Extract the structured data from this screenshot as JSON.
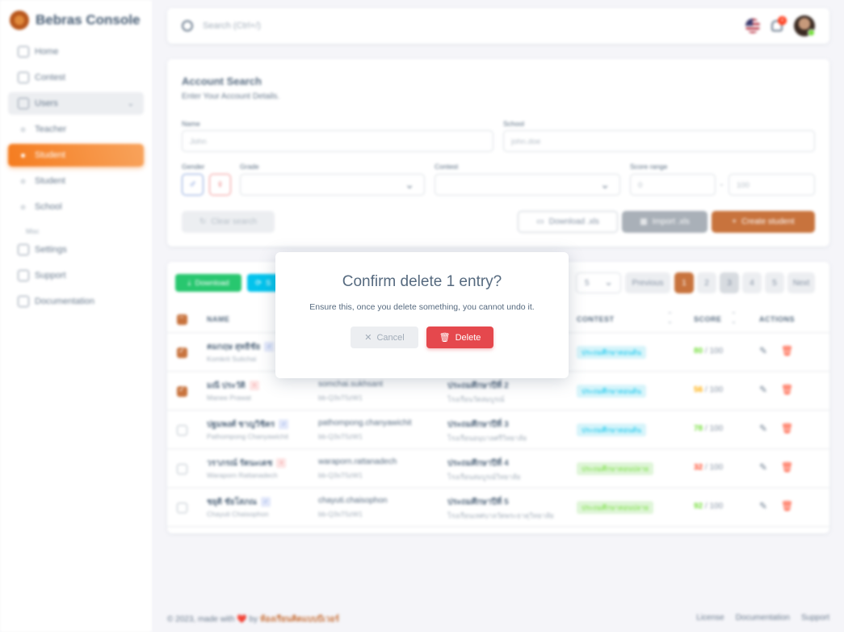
{
  "app": {
    "name": "Bebras Console"
  },
  "sidebar": {
    "items": [
      {
        "label": "Home"
      },
      {
        "label": "Contest"
      },
      {
        "label": "Users"
      }
    ],
    "users_sub": [
      {
        "label": "Teacher"
      },
      {
        "label": "Student"
      },
      {
        "label": "Student"
      },
      {
        "label": "School"
      }
    ],
    "misc_header": "Misc",
    "misc_items": [
      {
        "label": "Settings"
      },
      {
        "label": "Support"
      },
      {
        "label": "Documentation"
      }
    ]
  },
  "navbar": {
    "search_placeholder": "Search (Ctrl+/)",
    "notifications_count": "4"
  },
  "account_search": {
    "title": "Account Search",
    "subtitle": "Enter Your Account Details.",
    "name_label": "Name",
    "name_placeholder": "John",
    "school_label": "School",
    "school_placeholder": "john.doe",
    "gender_label": "Gender",
    "grade_label": "Grade",
    "contest_label": "Contest",
    "score_range_label": "Score range",
    "score_min_placeholder": "0",
    "score_dash": "-",
    "score_max_placeholder": "100",
    "clear_label": "Clear search",
    "download_label": "Download .xls",
    "import_label": "Import .xls",
    "create_label": "Create student"
  },
  "table": {
    "download_label": "Download",
    "partial_button_label": "S",
    "page_size": "5",
    "pagination": {
      "previous": "Previous",
      "pages": [
        "1",
        "2",
        "3",
        "4",
        "5"
      ],
      "next": "Next",
      "current": "1"
    },
    "headers": {
      "name": "NAME",
      "contest": "CONTEST",
      "score": "SCORE",
      "actions": "ACTIONS"
    },
    "rows": [
      {
        "name": "คมกฤษ สุทธิชัย",
        "name_en": "Komkrit Sutichai",
        "gender": "male",
        "username": "",
        "password": "",
        "level": "",
        "school": "",
        "contest": "ประถมศึกษาตอนต้น",
        "contest_type": "c1",
        "score": "80",
        "max": "/ 100",
        "score_color": "#71dd37",
        "checked": true
      },
      {
        "name": "มณี ประวัติ",
        "name_en": "Manee Prawat",
        "gender": "female",
        "username": "somchai.sukhsant",
        "password": "bb-Q3sT5zW1",
        "level": "ประถมศึกษาปีที่ 2",
        "school": "โรงเรียนวัดสมบูรณ์",
        "contest": "ประถมศึกษาตอนต้น",
        "contest_type": "c1",
        "score": "56",
        "max": "/ 100",
        "score_color": "#ffab00",
        "checked": true
      },
      {
        "name": "ปฐมพงศ์ ชาญวิชิตร",
        "name_en": "Pathompong Chanyawichit",
        "gender": "male",
        "username": "pathompong.chanyawichit",
        "password": "bb-Q3sT5zW1",
        "level": "ประถมศึกษาปีที่ 3",
        "school": "โรงเรียนอนุบาลศรีวิทยาลัย",
        "contest": "ประถมศึกษาตอนต้น",
        "contest_type": "c1",
        "score": "78",
        "max": "/ 100",
        "score_color": "#71dd37",
        "checked": false
      },
      {
        "name": "วราภรณ์ รัตนะเดช",
        "name_en": "Waraporn Rattanadech",
        "gender": "female",
        "username": "waraporn.rattanadech",
        "password": "bb-Q3sT5zW1",
        "level": "ประถมศึกษาปีที่ 4",
        "school": "โรงเรียนสมบูรณ์วิทยาลัย",
        "contest": "ประถมศึกษาตอนปลาย",
        "contest_type": "c2",
        "score": "32",
        "max": "/ 100",
        "score_color": "#ff3e1d",
        "checked": false
      },
      {
        "name": "ชยุติ ชัยโสภณ",
        "name_en": "Chayuti Chaisophon",
        "gender": "male",
        "username": "chayuti.chaisophon",
        "password": "bb-Q3sT5zW1",
        "level": "ประถมศึกษาปีที่ 5",
        "school": "โรงเรียนเทศบาลวัดพระธาตุวิทยาลัย",
        "contest": "ประถมศึกษาตอนปลาย",
        "contest_type": "c2",
        "score": "92",
        "max": "/ 100",
        "score_color": "#71dd37",
        "checked": false
      }
    ]
  },
  "footer": {
    "copyright": "© 2023, made with ❤️ by",
    "brand": "ห้องเรียนคิดแบบบีเวอร์",
    "links": [
      "License",
      "Documentation",
      "Support"
    ]
  },
  "modal": {
    "title": "Confirm delete 1 entry?",
    "message": "Ensure this, once you delete something, you cannot undo it.",
    "cancel_label": "Cancel",
    "delete_label": "Delete"
  }
}
